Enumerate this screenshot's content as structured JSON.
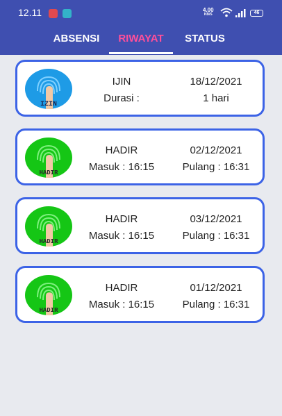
{
  "status_bar": {
    "time": "12.11",
    "net_speed_value": "4.00",
    "net_speed_unit": "KB/S",
    "battery": "46"
  },
  "tabs": [
    {
      "label": "ABSENSI",
      "active": false
    },
    {
      "label": "RIWAYAT",
      "active": true
    },
    {
      "label": "STATUS",
      "active": false
    }
  ],
  "colors": {
    "app_bar": "#3f4fb0",
    "active_tab": "#ff4f9a",
    "card_border": "#3c63e6",
    "ijin_icon": "#1e9be6",
    "hadir_icon": "#15c615"
  },
  "history": [
    {
      "status": "IJIN",
      "date": "18/12/2021",
      "left": "Durasi :",
      "right": "1 hari",
      "icon": "fingerprint-ijin-icon",
      "icon_label": "IZIN"
    },
    {
      "status": "HADIR",
      "date": "02/12/2021",
      "left": "Masuk : 16:15",
      "right": "Pulang : 16:31",
      "icon": "fingerprint-hadir-icon",
      "icon_label": "HADIR"
    },
    {
      "status": "HADIR",
      "date": "03/12/2021",
      "left": "Masuk : 16:15",
      "right": "Pulang : 16:31",
      "icon": "fingerprint-hadir-icon",
      "icon_label": "HADIR"
    },
    {
      "status": "HADIR",
      "date": "01/12/2021",
      "left": "Masuk : 16:15",
      "right": "Pulang : 16:31",
      "icon": "fingerprint-hadir-icon",
      "icon_label": "HADIR"
    }
  ]
}
